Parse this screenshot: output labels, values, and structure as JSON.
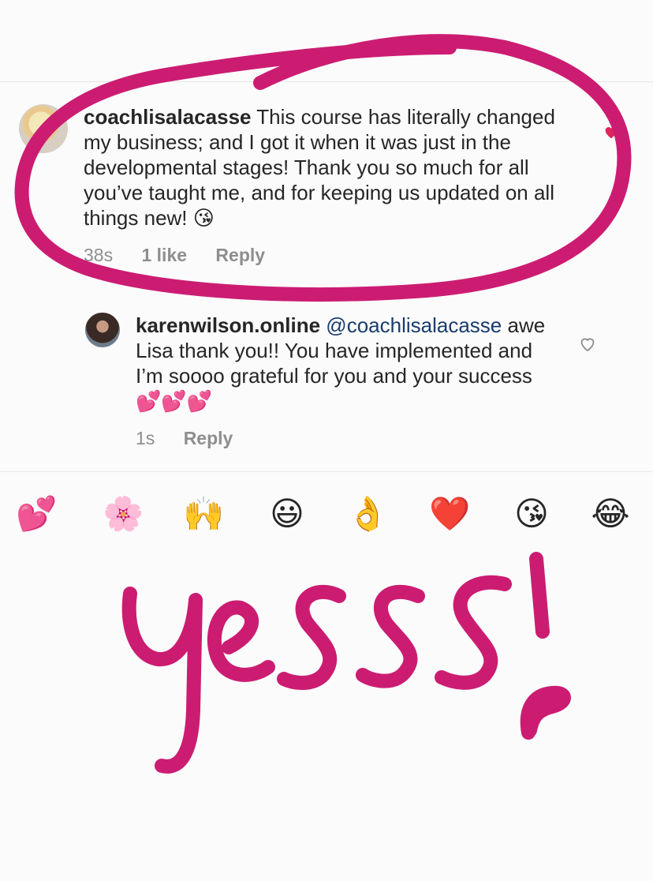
{
  "main_comment": {
    "username": "coachlisalacasse",
    "text": "This course has literally changed my business; and I got it when it was just in the developmental stages!  Thank you so much for all you’ve taught me, and for keeping us updated on all things new! 😘",
    "time": "38s",
    "likes": "1 like",
    "reply_label": "Reply"
  },
  "reply_comment": {
    "username": "karenwilson.online",
    "mention": "@coachlisalacasse",
    "text": "awe Lisa thank you!! You have implemented and I’m soooo grateful for you and your success 💕💕💕",
    "time": "1s",
    "reply_label": "Reply"
  },
  "emoji_bar": [
    "💕",
    "🌸",
    "🙌",
    "😃",
    "👌",
    "❤️",
    "😘",
    "😂"
  ],
  "annotation": {
    "handwritten_text": "yesss!",
    "color": "#cc1c72"
  },
  "colors": {
    "like_heart_main": "#e0245e",
    "divider": "#e6e6e6"
  }
}
